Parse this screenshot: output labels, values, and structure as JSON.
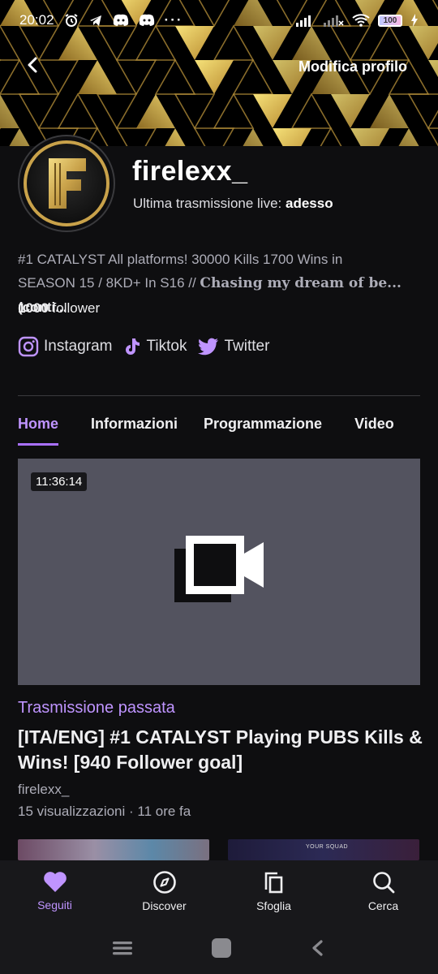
{
  "status_bar": {
    "time": "20:02",
    "battery": "100"
  },
  "header": {
    "edit_profile_label": "Modifica profilo"
  },
  "channel": {
    "name": "firelexx_",
    "last_live_label": "Ultima trasmissione live:",
    "last_live_value": "adesso",
    "bio_line1": "#1 CATALYST All platforms! 30000 Kills 1700 Wins in",
    "bio_line2_a": "SEASON 15 / 8KD+ In S16 // ",
    "bio_line2_b": "𝐂𝐡𝐚𝐬𝐢𝐧𝐠 𝐦𝐲 𝐝𝐫𝐞𝐚𝐦 𝐨𝐟 𝐛𝐞...",
    "bio_more": " (conti...",
    "followers_count": "1000",
    "followers_label": " follower"
  },
  "socials": [
    {
      "name": "Instagram",
      "icon": "instagram-icon"
    },
    {
      "name": "Tiktok",
      "icon": "tiktok-icon"
    },
    {
      "name": "Twitter",
      "icon": "twitter-icon"
    }
  ],
  "tabs": [
    {
      "label": "Home",
      "active": true
    },
    {
      "label": "Informazioni"
    },
    {
      "label": "Programmazione"
    },
    {
      "label": "Video"
    }
  ],
  "video": {
    "duration": "11:36:14",
    "category": "Trasmissione passata",
    "title": "[ITA/ENG] #1 CATALYST Playing PUBS Kills & Wins! [940 Follower goal]",
    "channel": "firelexx_",
    "meta": "15 visualizzazioni · 11 ore fa"
  },
  "peek": {
    "squad_label": "YOUR SQUAD"
  },
  "bottom_nav": [
    {
      "label": "Seguiti",
      "icon": "heart-icon",
      "active": true
    },
    {
      "label": "Discover",
      "icon": "compass-icon"
    },
    {
      "label": "Sfoglia",
      "icon": "browse-icon"
    },
    {
      "label": "Cerca",
      "icon": "search-icon"
    }
  ],
  "colors": {
    "accent": "#bf94ff",
    "background": "#0e0e10",
    "thumb": "#53535f",
    "gold": "#c9a24a"
  }
}
